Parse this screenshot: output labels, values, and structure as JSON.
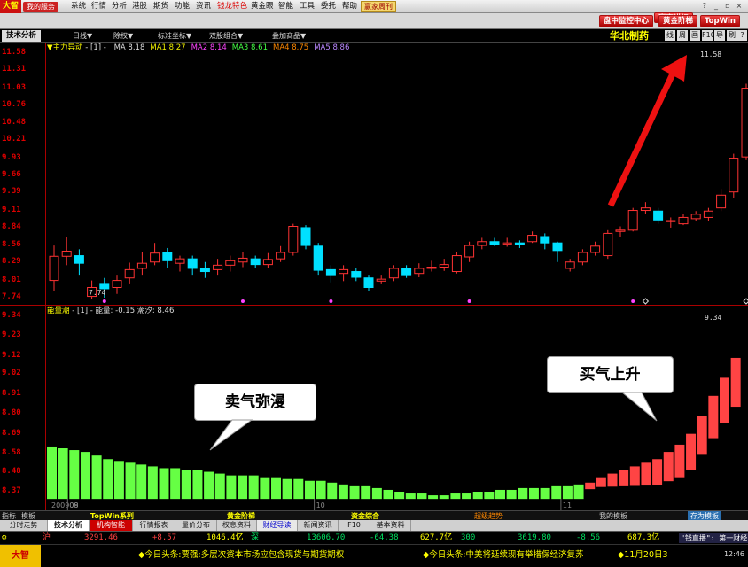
{
  "menu": {
    "logo": "大智",
    "my_service": "我的服务",
    "items": [
      "系统",
      "行情",
      "分析",
      "港股",
      "期货",
      "功能",
      "资讯",
      "钱龙特色",
      "黄金眼",
      "智能",
      "工具",
      "委托",
      "帮助"
    ],
    "highlight_item": "钱龙特色",
    "hot_button": "赢家周刊"
  },
  "toolbar2": {
    "btn1": "赢家讲坛",
    "btn2": "盘中监控中心",
    "btn3": "黄金阶梯",
    "btn4": "TopWin"
  },
  "tabrow": {
    "active_tab": "技术分析",
    "items": [
      "日线",
      "除权",
      "标准坐标",
      "双股组合",
      "叠加商品"
    ],
    "stock_name": "华北制药",
    "right_buttons": [
      "线",
      "周",
      "画",
      "F10",
      "导",
      "刷",
      "?"
    ]
  },
  "main_chart": {
    "indicator_name": "主力异动",
    "indicator_param": "[1]",
    "ma_items": [
      {
        "label": "MA",
        "value": "8.18",
        "color": "#dddddd"
      },
      {
        "label": "MA1",
        "value": "8.27",
        "color": "#f0f000"
      },
      {
        "label": "MA2",
        "value": "8.14",
        "color": "#ff44ff"
      },
      {
        "label": "MA3",
        "value": "8.61",
        "color": "#44ff44"
      },
      {
        "label": "MA4",
        "value": "8.75",
        "color": "#ff8800"
      },
      {
        "label": "MA5",
        "value": "8.86",
        "color": "#bb88ff"
      }
    ],
    "y_ticks": [
      "11.58",
      "11.31",
      "11.03",
      "10.76",
      "10.48",
      "10.21",
      "9.93",
      "9.66",
      "9.39",
      "9.11",
      "8.84",
      "8.56",
      "8.29",
      "8.01",
      "7.74"
    ],
    "high_label": "11.58",
    "low_label": "7.74",
    "up_color": "#ff3333",
    "down_color": "#00e0ff"
  },
  "chart_data": {
    "type": "candlestick",
    "candles": [
      [
        8.01,
        8.39,
        8.56,
        7.85
      ],
      [
        8.39,
        8.47,
        8.7,
        8.25
      ],
      [
        8.4,
        8.28,
        8.5,
        8.1
      ],
      [
        7.76,
        7.9,
        8.01,
        7.72
      ],
      [
        7.95,
        7.88,
        8.05,
        7.74
      ],
      [
        7.9,
        8.01,
        8.1,
        7.8
      ],
      [
        8.05,
        8.18,
        8.29,
        7.95
      ],
      [
        8.2,
        8.28,
        8.45,
        8.1
      ],
      [
        8.3,
        8.44,
        8.6,
        8.25
      ],
      [
        8.45,
        8.32,
        8.52,
        8.2
      ],
      [
        8.28,
        8.35,
        8.4,
        8.15
      ],
      [
        8.35,
        8.2,
        8.4,
        8.1
      ],
      [
        8.2,
        8.15,
        8.3,
        8.05
      ],
      [
        8.18,
        8.25,
        8.35,
        8.1
      ],
      [
        8.25,
        8.32,
        8.4,
        8.15
      ],
      [
        8.3,
        8.36,
        8.45,
        8.22
      ],
      [
        8.35,
        8.26,
        8.4,
        8.2
      ],
      [
        8.26,
        8.34,
        8.44,
        8.2
      ],
      [
        8.35,
        8.45,
        8.55,
        8.3
      ],
      [
        8.45,
        8.86,
        8.9,
        8.4
      ],
      [
        8.84,
        8.56,
        8.88,
        8.5
      ],
      [
        8.55,
        8.17,
        8.6,
        8.1
      ],
      [
        8.18,
        8.1,
        8.25,
        7.98
      ],
      [
        8.12,
        8.18,
        8.25,
        8.0
      ],
      [
        8.15,
        8.06,
        8.2,
        8.0
      ],
      [
        8.05,
        7.9,
        8.1,
        7.85
      ],
      [
        8.0,
        8.03,
        8.1,
        7.95
      ],
      [
        8.05,
        8.2,
        8.25,
        8.0
      ],
      [
        8.2,
        8.1,
        8.25,
        8.05
      ],
      [
        8.12,
        8.2,
        8.28,
        8.06
      ],
      [
        8.2,
        8.22,
        8.32,
        8.15
      ],
      [
        8.22,
        8.26,
        8.35,
        8.16
      ],
      [
        8.15,
        8.4,
        8.45,
        8.12
      ],
      [
        8.38,
        8.56,
        8.62,
        8.3
      ],
      [
        8.56,
        8.62,
        8.68,
        8.5
      ],
      [
        8.62,
        8.58,
        8.68,
        8.55
      ],
      [
        8.58,
        8.6,
        8.68,
        8.54
      ],
      [
        8.6,
        8.57,
        8.64,
        8.52
      ],
      [
        8.62,
        8.72,
        8.78,
        8.6
      ],
      [
        8.7,
        8.6,
        8.75,
        8.5
      ],
      [
        8.6,
        8.48,
        8.62,
        8.3
      ],
      [
        8.2,
        8.3,
        8.35,
        8.15
      ],
      [
        8.3,
        8.45,
        8.5,
        8.25
      ],
      [
        8.45,
        8.55,
        8.62,
        8.4
      ],
      [
        8.4,
        8.75,
        8.8,
        8.35
      ],
      [
        8.78,
        8.8,
        8.86,
        8.7
      ],
      [
        8.8,
        9.11,
        9.15,
        8.78
      ],
      [
        9.11,
        9.15,
        9.24,
        9.05
      ],
      [
        9.1,
        8.96,
        9.15,
        8.9
      ],
      [
        8.95,
        8.95,
        9.0,
        8.84
      ],
      [
        8.9,
        9.0,
        9.05,
        8.88
      ],
      [
        8.98,
        9.05,
        9.1,
        8.95
      ],
      [
        9.0,
        9.1,
        9.15,
        8.95
      ],
      [
        9.15,
        9.35,
        9.45,
        9.1
      ],
      [
        9.4,
        9.93,
        10.0,
        9.3
      ],
      [
        9.95,
        11.03,
        11.1,
        9.9
      ],
      [
        11.03,
        11.05,
        11.2,
        10.95
      ],
      [
        11.1,
        11.45,
        11.58,
        11.05
      ]
    ],
    "signal_markers": [
      {
        "index": 4,
        "type": "dot"
      },
      {
        "index": 15,
        "type": "dot"
      },
      {
        "index": 22,
        "type": "dot"
      },
      {
        "index": 33,
        "type": "dot"
      },
      {
        "index": 46,
        "type": "dot"
      },
      {
        "index": 47,
        "type": "diamond"
      },
      {
        "index": 55,
        "type": "diamond"
      }
    ],
    "energy": {
      "name": "能量潮",
      "param": "[1]",
      "label_a": "能量",
      "value_a": "-0.15",
      "label_b": "潮汐",
      "value_b": "8.46",
      "y_ticks": [
        "9.34",
        "9.23",
        "9.12",
        "9.02",
        "8.91",
        "8.80",
        "8.69",
        "8.58",
        "8.48",
        "8.37"
      ],
      "max_label": "9.34",
      "bars": [
        8.62,
        8.61,
        8.6,
        8.59,
        8.57,
        8.55,
        8.54,
        8.53,
        8.52,
        8.51,
        8.5,
        8.5,
        8.49,
        8.49,
        8.48,
        8.47,
        8.46,
        8.46,
        8.46,
        8.45,
        8.45,
        8.44,
        8.44,
        8.43,
        8.43,
        8.42,
        8.41,
        8.4,
        8.4,
        8.39,
        8.38,
        8.37,
        8.36,
        8.36,
        8.35,
        8.35,
        8.36,
        8.36,
        8.37,
        8.37,
        8.38,
        8.38,
        8.39,
        8.39,
        8.39,
        8.4,
        8.4,
        8.41,
        8.42,
        8.45,
        8.47,
        8.49,
        8.51,
        8.53,
        8.55,
        8.59,
        8.63,
        8.69,
        8.79,
        8.9,
        9.0,
        9.11
      ],
      "baseline": 8.33,
      "rising_from_index": 48,
      "green": "#66ff44",
      "red": "#ff4444"
    },
    "x_labels": [
      {
        "index": 0,
        "text": "200908"
      },
      {
        "index": 2,
        "text": "09"
      },
      {
        "index": 24,
        "text": "10"
      },
      {
        "index": 46,
        "text": "11"
      }
    ]
  },
  "callouts": {
    "sell": "卖气弥漫",
    "buy": "买气上升"
  },
  "bottom_tabs": {
    "left": [
      "指标",
      "模板"
    ],
    "items": [
      "TopWin系列",
      "黄金阶梯",
      "资金综合",
      "超级趋势"
    ],
    "my_template": "我的模板",
    "save_template": "存为模板"
  },
  "main_tabs": [
    "分时走势",
    "技术分析",
    "机构智能",
    "行情报表",
    "量价分布",
    "权息资料",
    "财经导读",
    "新闻资讯",
    "F10",
    "基本资料"
  ],
  "ticker": {
    "sh_label": "沪",
    "sh_index": "3291.46",
    "sh_change": "+8.57",
    "sh_amount": "1046.4亿",
    "sz_label": "深",
    "sz_index": "13606.70",
    "sz_change": "-64.38",
    "sz_amount": "627.7亿",
    "c300_label": "300",
    "c300_index": "3619.80",
    "c300_change": "-8.56",
    "c300_amount": "687.3亿",
    "right_tag": "\"钱直播\": 第一财经"
  },
  "news": {
    "logo": "大智",
    "headline1": "◆今日头条:贾强:多层次资本市场应包含现货与期货期权",
    "headline2": "◆今日头条:中美将延续现有举措保经济复苏",
    "headline3": "◆11月20日3",
    "clock": "12:46"
  }
}
